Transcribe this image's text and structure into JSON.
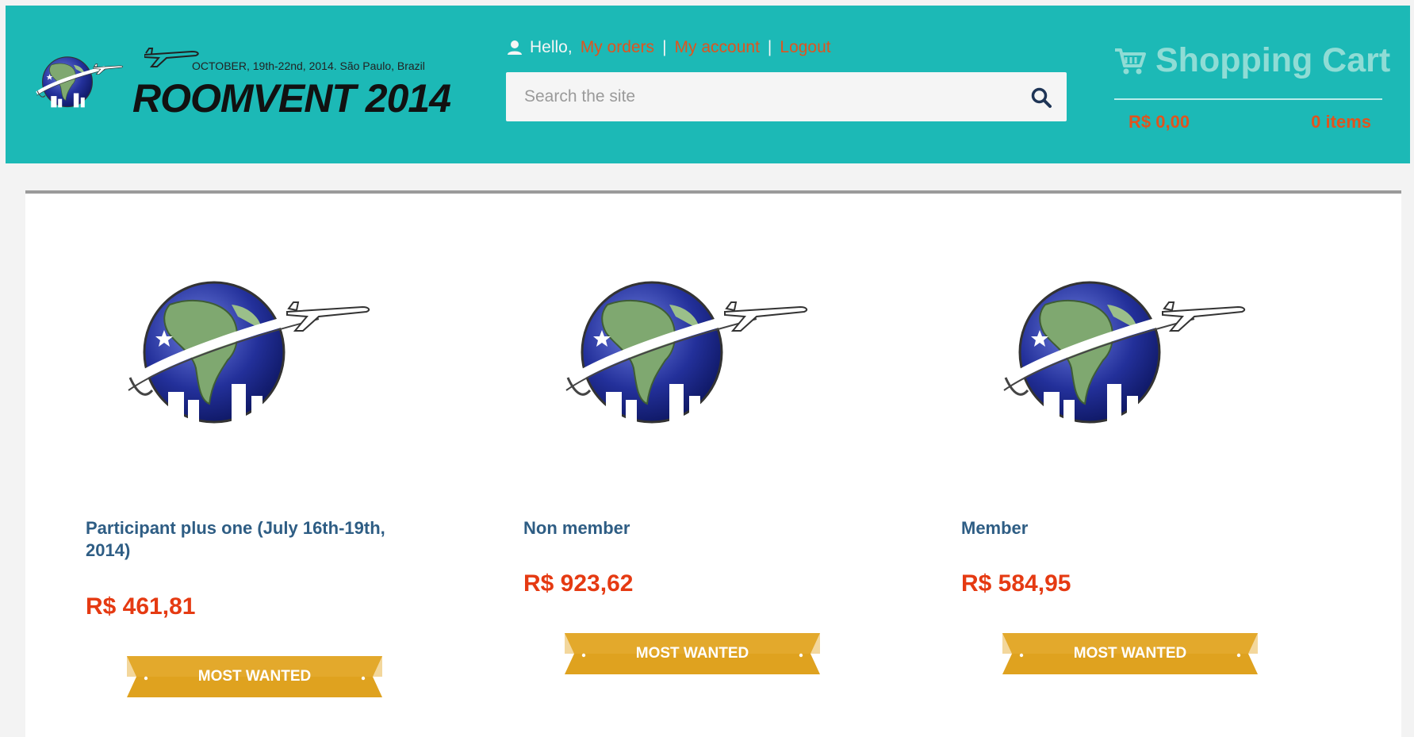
{
  "header": {
    "logo_tagline": "OCTOBER, 19th-22nd, 2014. São Paulo, Brazil",
    "logo_title": "ROOMVENT 2014",
    "user": {
      "greeting": "Hello,",
      "my_orders": "My orders",
      "separator": "|",
      "my_account": "My account",
      "logout": "Logout"
    },
    "search": {
      "placeholder": "Search the site",
      "value": ""
    },
    "cart": {
      "title": "Shopping Cart",
      "total": "R$ 0,00",
      "items": "0 items"
    }
  },
  "products": [
    {
      "name": "Participant plus one (July 16th-19th, 2014)",
      "price": "R$ 461,81",
      "badge": "MOST WANTED"
    },
    {
      "name": "Non member",
      "price": "R$ 923,62",
      "badge": "MOST WANTED"
    },
    {
      "name": "Member",
      "price": "R$ 584,95",
      "badge": "MOST WANTED"
    }
  ],
  "colors": {
    "header_bg": "#1cb9b6",
    "link": "#e0541e",
    "price": "#e53a12",
    "product_name": "#2e5d84",
    "badge": "#dfa21f"
  },
  "icons": [
    "user-icon",
    "search-icon",
    "cart-icon",
    "globe-logo-icon",
    "airplane-icon"
  ]
}
